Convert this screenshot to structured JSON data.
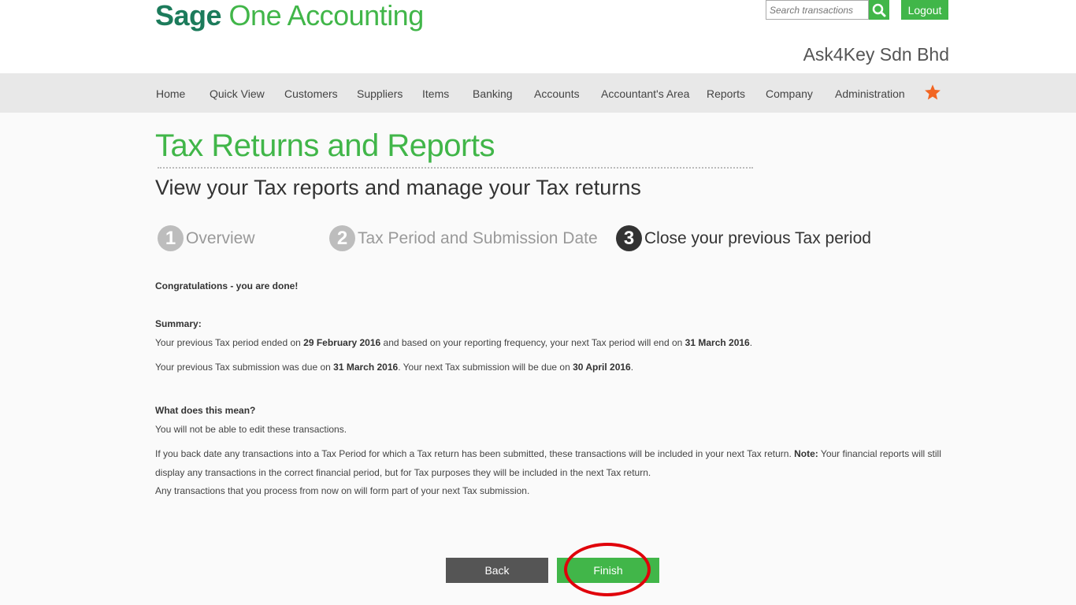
{
  "brand": {
    "name_bold": "Sage",
    "name_rest": " One Accounting"
  },
  "search": {
    "placeholder": "Search transactions"
  },
  "header": {
    "logout_label": "Logout",
    "company_name": "Ask4Key Sdn Bhd"
  },
  "nav": {
    "items": [
      "Home",
      "Quick View",
      "Customers",
      "Suppliers",
      "Items",
      "Banking",
      "Accounts",
      "Accountant's Area",
      "Reports",
      "Company",
      "Administration"
    ],
    "favorites_icon": "star-icon"
  },
  "page": {
    "title": "Tax Returns and Reports",
    "subtitle": "View your Tax reports and manage your Tax returns"
  },
  "steps": [
    {
      "number": "1",
      "label": "Overview",
      "state": "inactive"
    },
    {
      "number": "2",
      "label": "Tax Period and Submission Date",
      "state": "inactive"
    },
    {
      "number": "3",
      "label": "Close your previous Tax period",
      "state": "active"
    }
  ],
  "content": {
    "congrats": "Congratulations - you are done!",
    "summary_heading": "Summary:",
    "summary_line1": {
      "p1": "Your previous Tax period ended on ",
      "d1": "29 February 2016",
      "p2": " and based on your reporting frequency, your next Tax period will end on ",
      "d2": "31 March 2016",
      "p3": "."
    },
    "summary_line2": {
      "p1": "Your previous Tax submission was due on ",
      "d1": "31 March 2016",
      "p2": ". Your next Tax submission will be due on ",
      "d2": "30 April 2016",
      "p3": "."
    },
    "meaning_heading": "What does this mean?",
    "meaning_line1": "You will not be able to edit these transactions.",
    "meaning_line2": {
      "p1": "If you back date any transactions into a Tax Period for which a Tax return has been submitted, these transactions will be included in your next Tax return. ",
      "note": "Note:",
      "p2": " Your financial reports will still"
    },
    "meaning_line3": "display any transactions in the correct financial period, but for Tax purposes they will be included in the next Tax return.",
    "meaning_line4": "Any transactions that you process from now on will form part of your next Tax submission."
  },
  "buttons": {
    "back_label": "Back",
    "finish_label": "Finish"
  },
  "colors": {
    "brand_dark": "#1c7b5b",
    "brand_green": "#41b649",
    "back_button": "#555555",
    "annotation_red": "#e0000a",
    "star": "#f26522"
  }
}
